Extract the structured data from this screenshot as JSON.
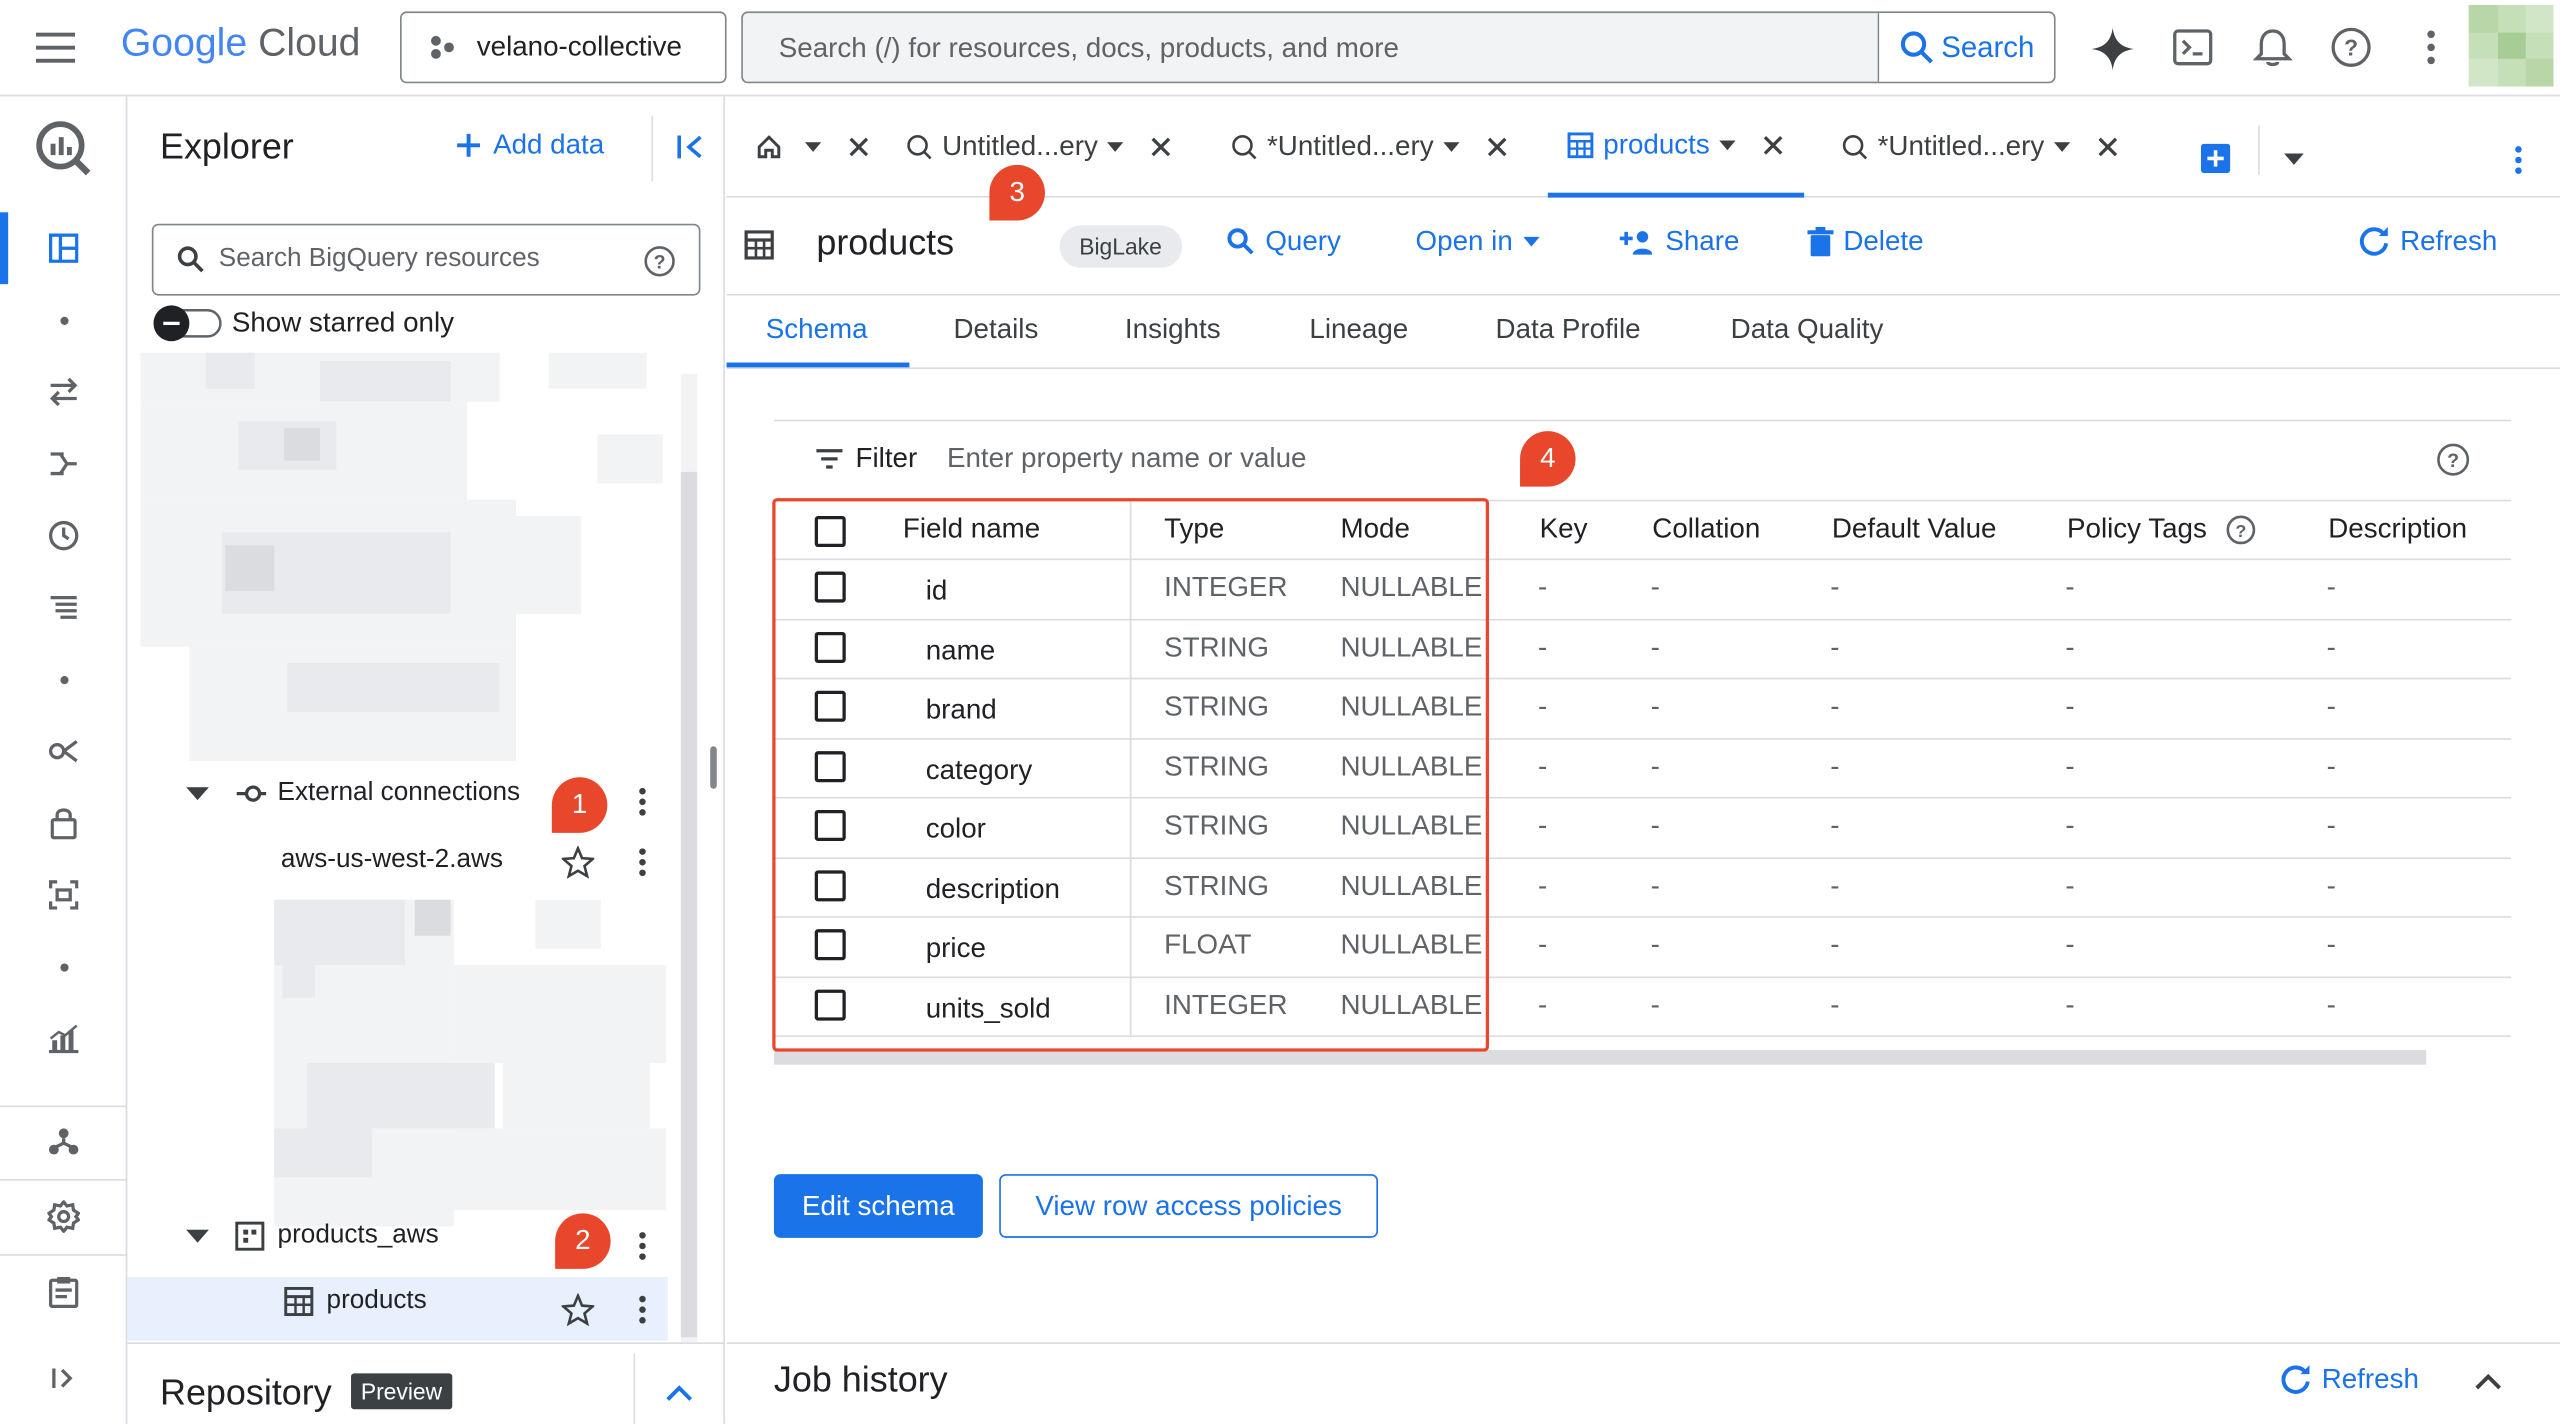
{
  "topbar": {
    "logo_google": "Google",
    "logo_cloud": "Cloud",
    "project": "velano-collective",
    "search_placeholder": "Search (/) for resources, docs, products, and more",
    "search_button": "Search"
  },
  "explorer": {
    "title": "Explorer",
    "add_data": "Add data",
    "search_placeholder": "Search BigQuery resources",
    "starred_toggle": "Show starred only",
    "tree": {
      "external_connections": "External connections",
      "aws_connection": "aws-us-west-2.aws",
      "dataset": "products_aws",
      "table": "products"
    }
  },
  "repository": {
    "title": "Repository",
    "badge": "Preview"
  },
  "badges": [
    "1",
    "2",
    "3",
    "4"
  ],
  "tabs": [
    {
      "label": "Untitled...ery"
    },
    {
      "label": "*Untitled...ery"
    },
    {
      "label": "products"
    },
    {
      "label": "*Untitled...ery"
    }
  ],
  "header": {
    "title": "products",
    "chip": "BigLake",
    "query": "Query",
    "open_in": "Open in",
    "share": "Share",
    "delete": "Delete",
    "refresh": "Refresh"
  },
  "subtabs": [
    "Schema",
    "Details",
    "Insights",
    "Lineage",
    "Data Profile",
    "Data Quality"
  ],
  "schema": {
    "filter_label": "Filter",
    "filter_placeholder": "Enter property name or value",
    "columns": [
      "Field name",
      "Type",
      "Mode",
      "Key",
      "Collation",
      "Default Value",
      "Policy Tags",
      "Description"
    ],
    "rows": [
      {
        "name": "id",
        "type": "INTEGER",
        "mode": "NULLABLE",
        "key": "-",
        "collation": "-",
        "default": "-",
        "policy": "-",
        "description": "-"
      },
      {
        "name": "name",
        "type": "STRING",
        "mode": "NULLABLE",
        "key": "-",
        "collation": "-",
        "default": "-",
        "policy": "-",
        "description": "-"
      },
      {
        "name": "brand",
        "type": "STRING",
        "mode": "NULLABLE",
        "key": "-",
        "collation": "-",
        "default": "-",
        "policy": "-",
        "description": "-"
      },
      {
        "name": "category",
        "type": "STRING",
        "mode": "NULLABLE",
        "key": "-",
        "collation": "-",
        "default": "-",
        "policy": "-",
        "description": "-"
      },
      {
        "name": "color",
        "type": "STRING",
        "mode": "NULLABLE",
        "key": "-",
        "collation": "-",
        "default": "-",
        "policy": "-",
        "description": "-"
      },
      {
        "name": "description",
        "type": "STRING",
        "mode": "NULLABLE",
        "key": "-",
        "collation": "-",
        "default": "-",
        "policy": "-",
        "description": "-"
      },
      {
        "name": "price",
        "type": "FLOAT",
        "mode": "NULLABLE",
        "key": "-",
        "collation": "-",
        "default": "-",
        "policy": "-",
        "description": "-"
      },
      {
        "name": "units_sold",
        "type": "INTEGER",
        "mode": "NULLABLE",
        "key": "-",
        "collation": "-",
        "default": "-",
        "policy": "-",
        "description": "-"
      }
    ],
    "edit_schema": "Edit schema",
    "row_access": "View row access policies"
  },
  "job_history": {
    "title": "Job history",
    "refresh": "Refresh"
  },
  "colors": {
    "accent": "#1a73e8",
    "badge": "#e8472b",
    "highlight_box": "#e8472b"
  }
}
